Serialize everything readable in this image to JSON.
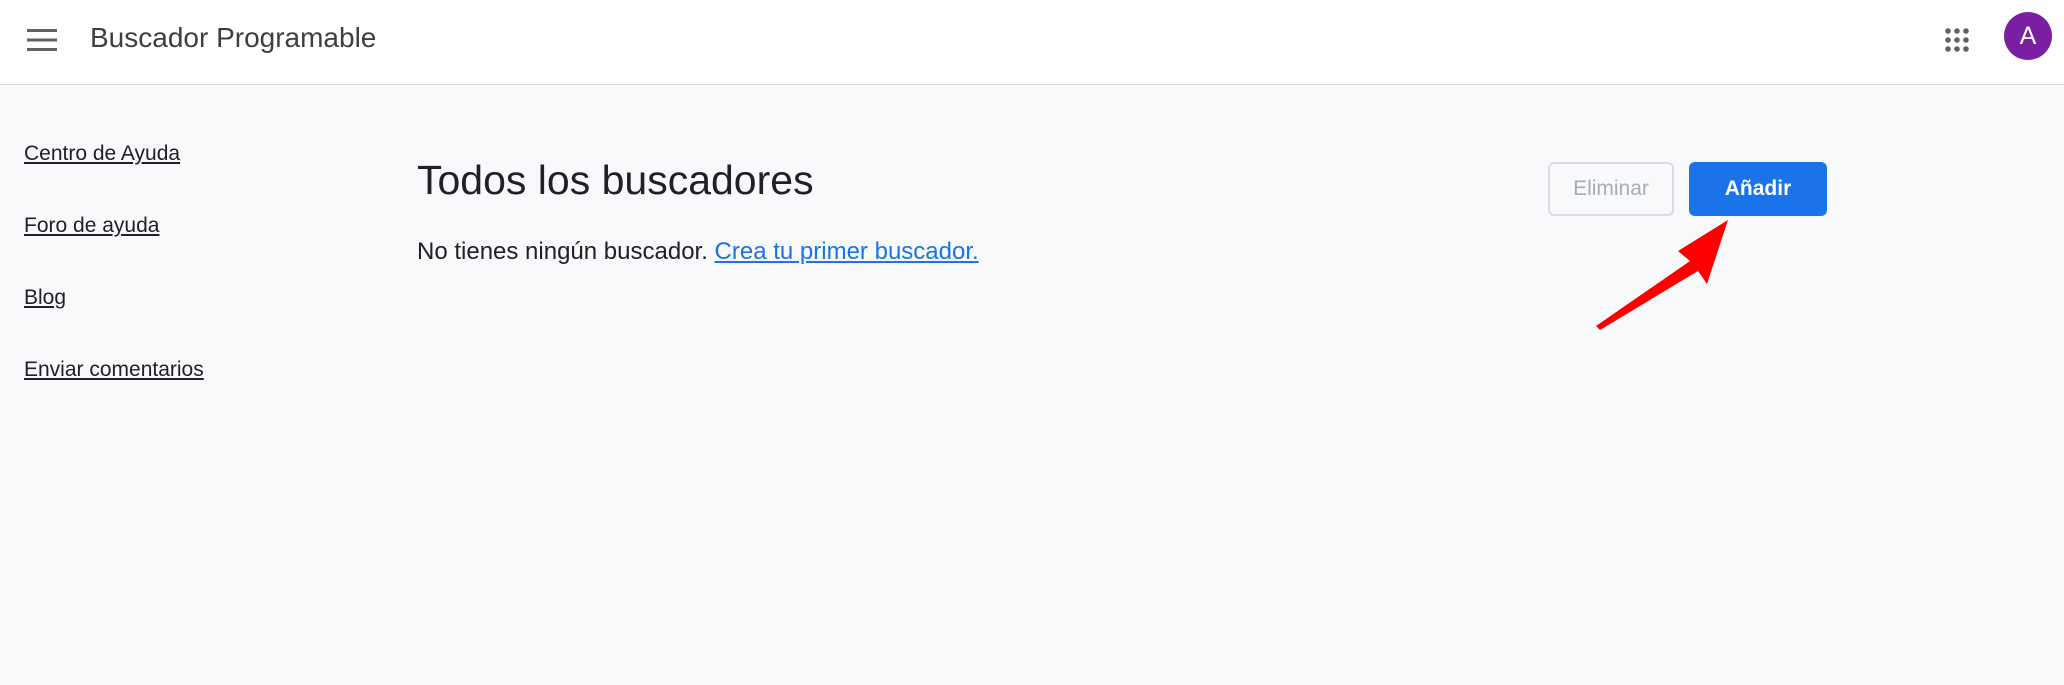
{
  "header": {
    "title": "Buscador Programable",
    "menu_icon": "hamburger-menu-icon",
    "apps_icon": "apps-grid-icon",
    "avatar_letter": "A",
    "avatar_color": "#7b1fa2"
  },
  "sidebar": {
    "items": [
      {
        "label": "Centro de Ayuda"
      },
      {
        "label": "Foro de ayuda"
      },
      {
        "label": "Blog"
      },
      {
        "label": "Enviar comentarios"
      }
    ]
  },
  "main": {
    "title": "Todos los buscadores",
    "empty_text": "No tienes ningún buscador.",
    "create_link": "Crea tu primer buscador.",
    "delete_label": "Eliminar",
    "add_label": "Añadir"
  },
  "colors": {
    "primary": "#1a73e8",
    "annotation": "#ff0000"
  }
}
